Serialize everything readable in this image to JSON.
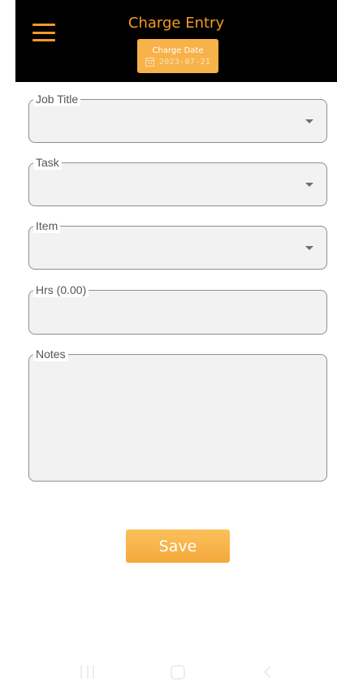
{
  "header": {
    "title": "Charge Entry",
    "date_label": "Charge Date",
    "date_value": "2023-07-21"
  },
  "form": {
    "job_title_label": "Job Title",
    "task_label": "Task",
    "item_label": "Item",
    "hours_label": "Hrs (0.00)",
    "notes_label": "Notes",
    "save_label": "Save"
  },
  "icons": {
    "menu": "hamburger-menu-icon",
    "calendar": "calendar-icon",
    "dropdown": "chevron-down-icon",
    "nav_recents": "recents-icon",
    "nav_home": "home-icon",
    "nav_back": "back-icon"
  },
  "colors": {
    "accent": "#f39a26",
    "button": "#f7b24a",
    "header_bg": "#000000",
    "field_bg": "#f2f2f2"
  }
}
